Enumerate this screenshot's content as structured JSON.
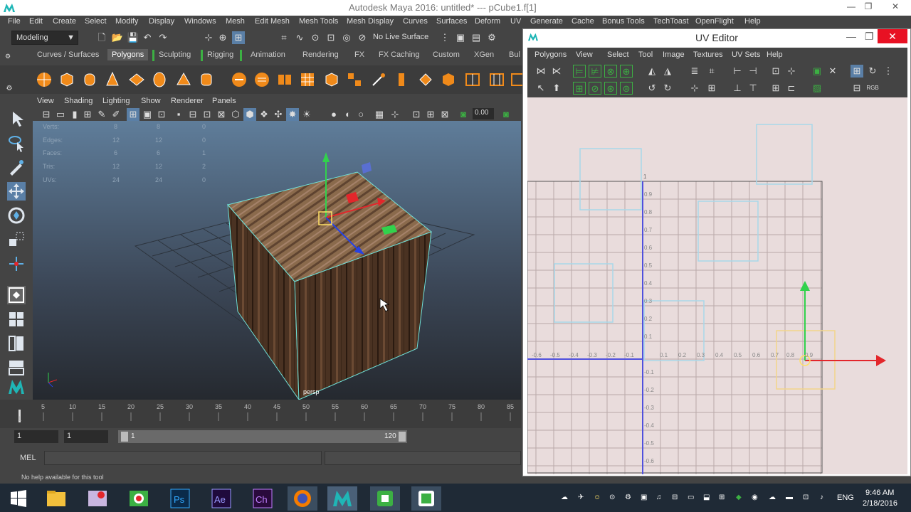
{
  "window": {
    "title": "Autodesk Maya 2016: untitled*   ---   pCube1.f[1]",
    "min": "—",
    "max": "❐",
    "close": "✕"
  },
  "menubar": [
    "File",
    "Edit",
    "Create",
    "Select",
    "Modify",
    "Display",
    "Windows",
    "Mesh",
    "Edit Mesh",
    "Mesh Tools",
    "Mesh Display",
    "Curves",
    "Surfaces",
    "Deform",
    "UV",
    "Generate",
    "Cache",
    "Bonus Tools",
    "TechToast",
    "OpenFlight",
    "Help"
  ],
  "status": {
    "mode": "Modeling",
    "live_surface": "No Live Surface"
  },
  "shelf_tabs": [
    "Curves / Surfaces",
    "Polygons",
    "Sculpting",
    "Rigging",
    "Animation",
    "Rendering",
    "FX",
    "FX Caching",
    "Custom",
    "XGen",
    "Bul"
  ],
  "viewport": {
    "menu": [
      "View",
      "Shading",
      "Lighting",
      "Show",
      "Renderer",
      "Panels"
    ],
    "field_value": "0.00",
    "camera": "persp",
    "hud": [
      {
        "label": "Verts:",
        "a": "8",
        "b": "8",
        "c": "0"
      },
      {
        "label": "Edges:",
        "a": "12",
        "b": "12",
        "c": "0"
      },
      {
        "label": "Faces:",
        "a": "6",
        "b": "6",
        "c": "1"
      },
      {
        "label": "Tris:",
        "a": "12",
        "b": "12",
        "c": "2"
      },
      {
        "label": "UVs:",
        "a": "24",
        "b": "24",
        "c": "0"
      }
    ]
  },
  "timeline": {
    "ticks": [
      "1",
      "5",
      "10",
      "15",
      "20",
      "25",
      "30",
      "35",
      "40",
      "45",
      "50",
      "55",
      "60",
      "65",
      "70",
      "75",
      "80",
      "85"
    ],
    "start": "1",
    "current": "1",
    "range_start": "1",
    "range_end": "120"
  },
  "cmd": {
    "label": "MEL",
    "help": "No help available for this tool"
  },
  "uv_editor": {
    "title": "UV Editor",
    "menu": [
      "Polygons",
      "View",
      "Select",
      "Tool",
      "Image",
      "Textures",
      "UV Sets",
      "Help"
    ],
    "v_labels": [
      "1",
      "0.9",
      "0.8",
      "0.7",
      "0.6",
      "0.5",
      "0.4",
      "0.3",
      "0.2",
      "0.1",
      "-0.1",
      "-0.2",
      "-0.3",
      "-0.4",
      "-0.5",
      "-0.6"
    ],
    "u_labels": [
      "-0.6",
      "-0.5",
      "-0.4",
      "-0.3",
      "-0.2",
      "-0.1",
      "0.1",
      "0.2",
      "0.3",
      "0.4",
      "0.5",
      "0.6",
      "0.7",
      "0.8",
      "0.9"
    ]
  },
  "taskbar": {
    "lang": "ENG",
    "time": "9:46 AM",
    "date": "2/18/2016"
  },
  "colors": {
    "accent_green": "#3cb043",
    "uv_bg": "#e9dcdc",
    "manip_red": "#e3262b"
  }
}
